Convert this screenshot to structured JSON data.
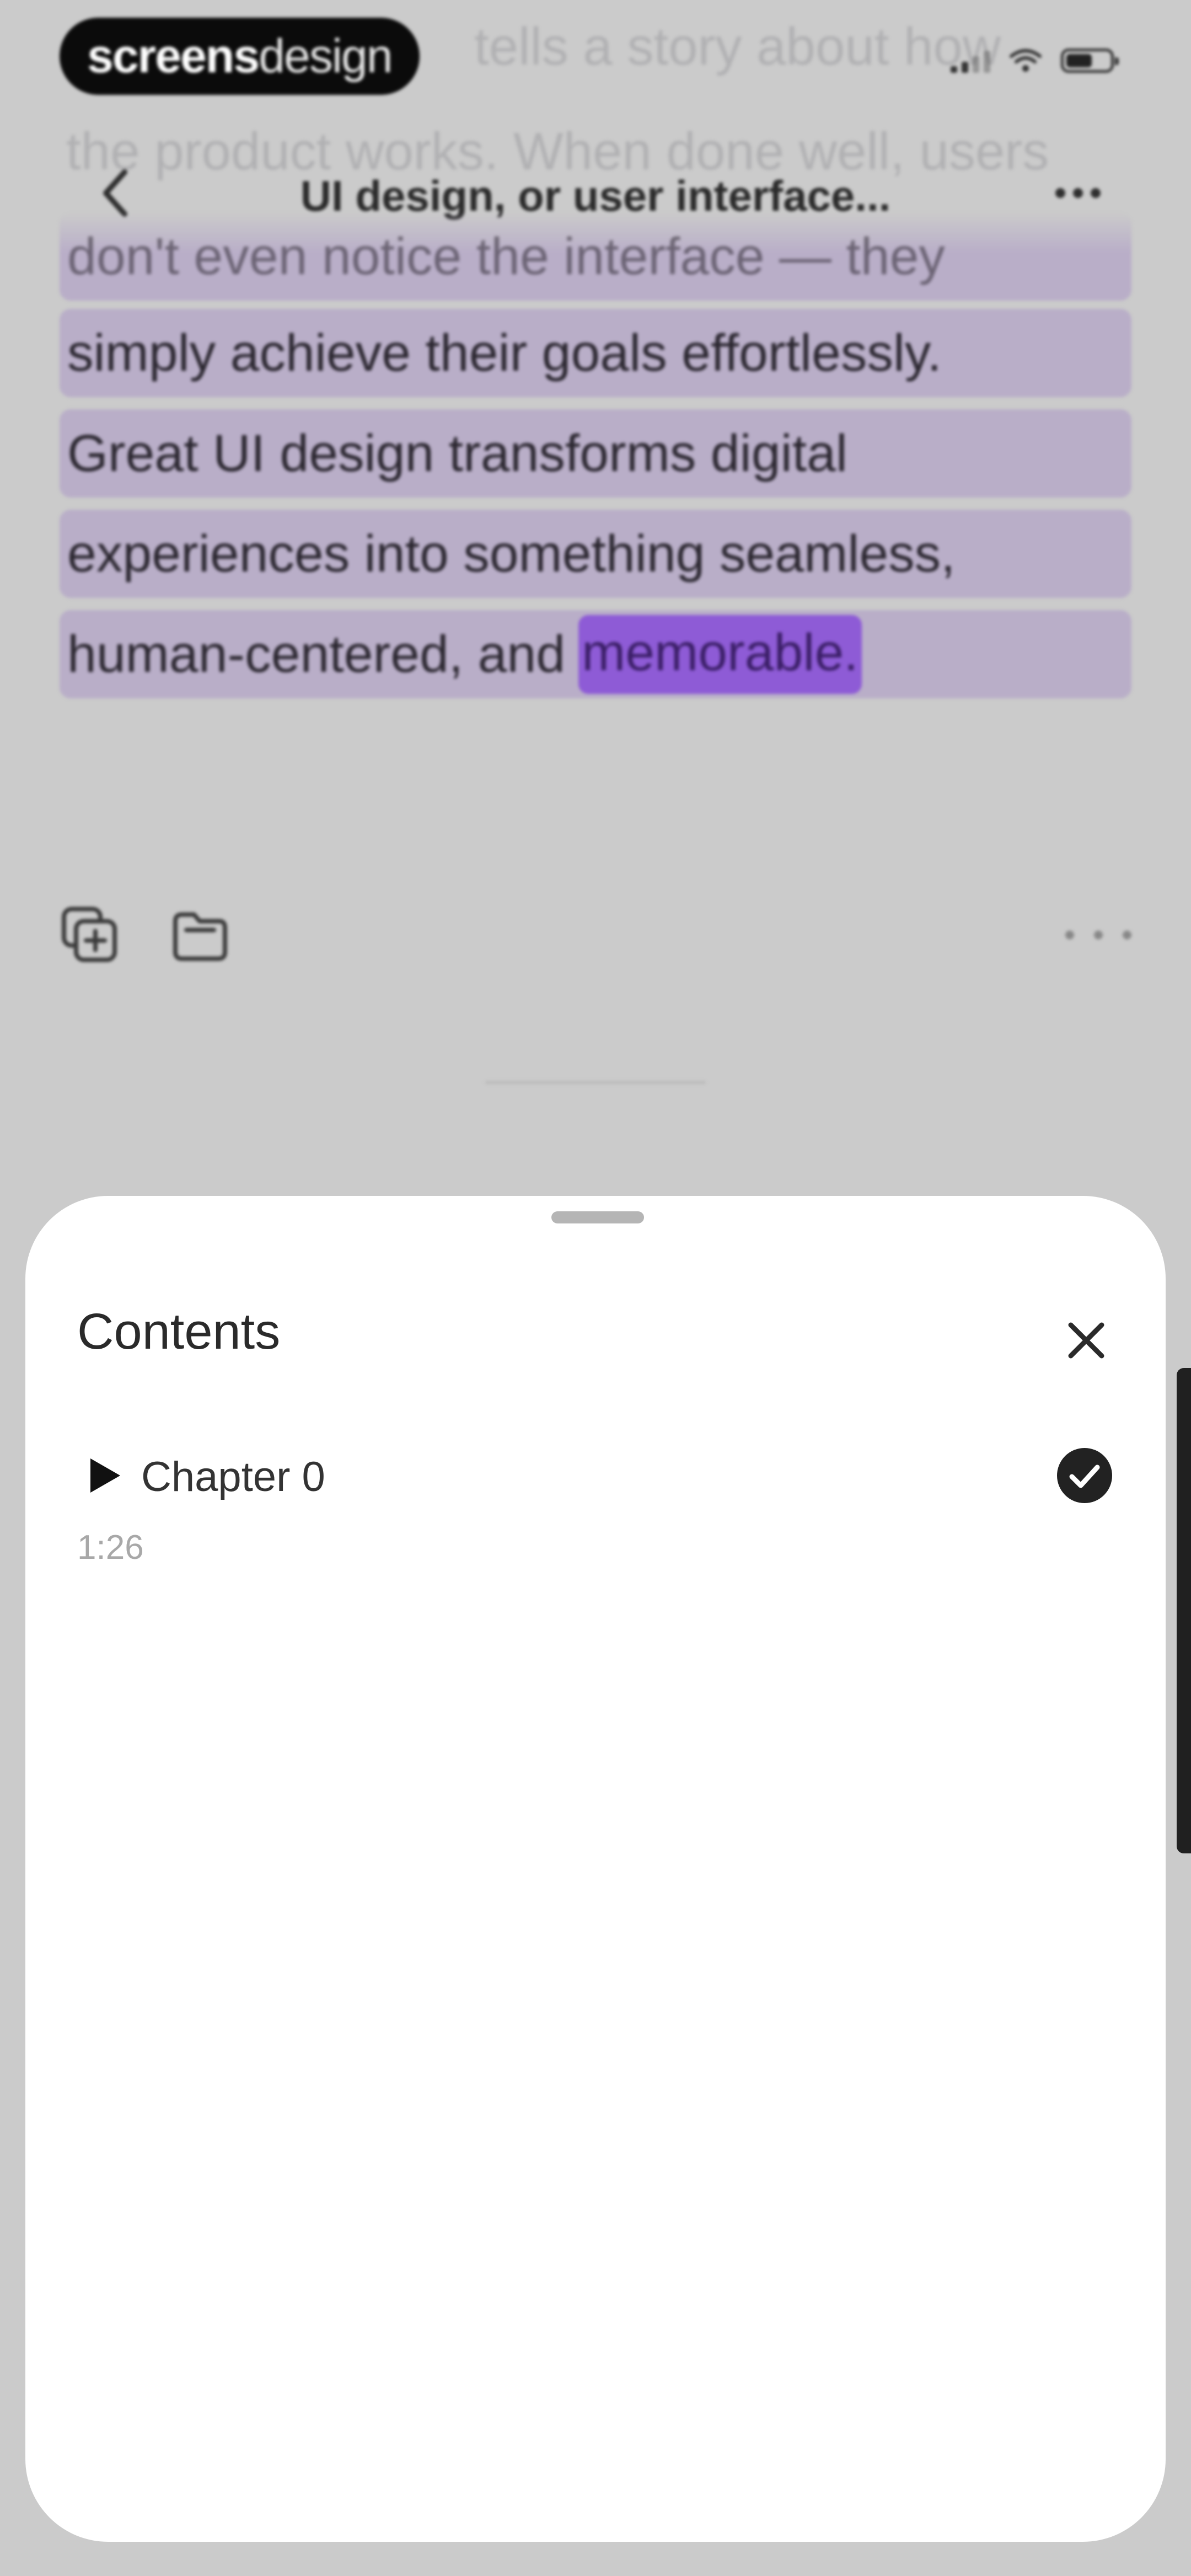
{
  "watermark": {
    "bold": "screens",
    "light": "design"
  },
  "reader": {
    "faded_lines": [
      "tells a story about how",
      "the product works. When done well, users"
    ],
    "nav_title": "UI design, or user interface...",
    "highlighted_lines": [
      "don't even notice the interface — they",
      "simply achieve their goals effortlessly.",
      "Great UI design transforms digital",
      "experiences into something seamless,"
    ],
    "last_line_prefix": "human-centered, and",
    "active_word": "memorable."
  },
  "sheet": {
    "title": "Contents",
    "chapters": [
      {
        "label": "Chapter 0",
        "duration": "1:26",
        "completed": true
      }
    ]
  },
  "icons": {
    "back": "chevron-left-icon",
    "more": "ellipsis-icon",
    "copy": "copy-plus-icon",
    "folder": "folder-save-icon",
    "close": "close-icon",
    "play": "play-icon",
    "check": "check-circle-icon"
  },
  "colors": {
    "highlight": "#b9aec8",
    "active_word": "#8e5bd6",
    "backdrop": "#cbcbcb",
    "sheet": "#ffffff"
  }
}
